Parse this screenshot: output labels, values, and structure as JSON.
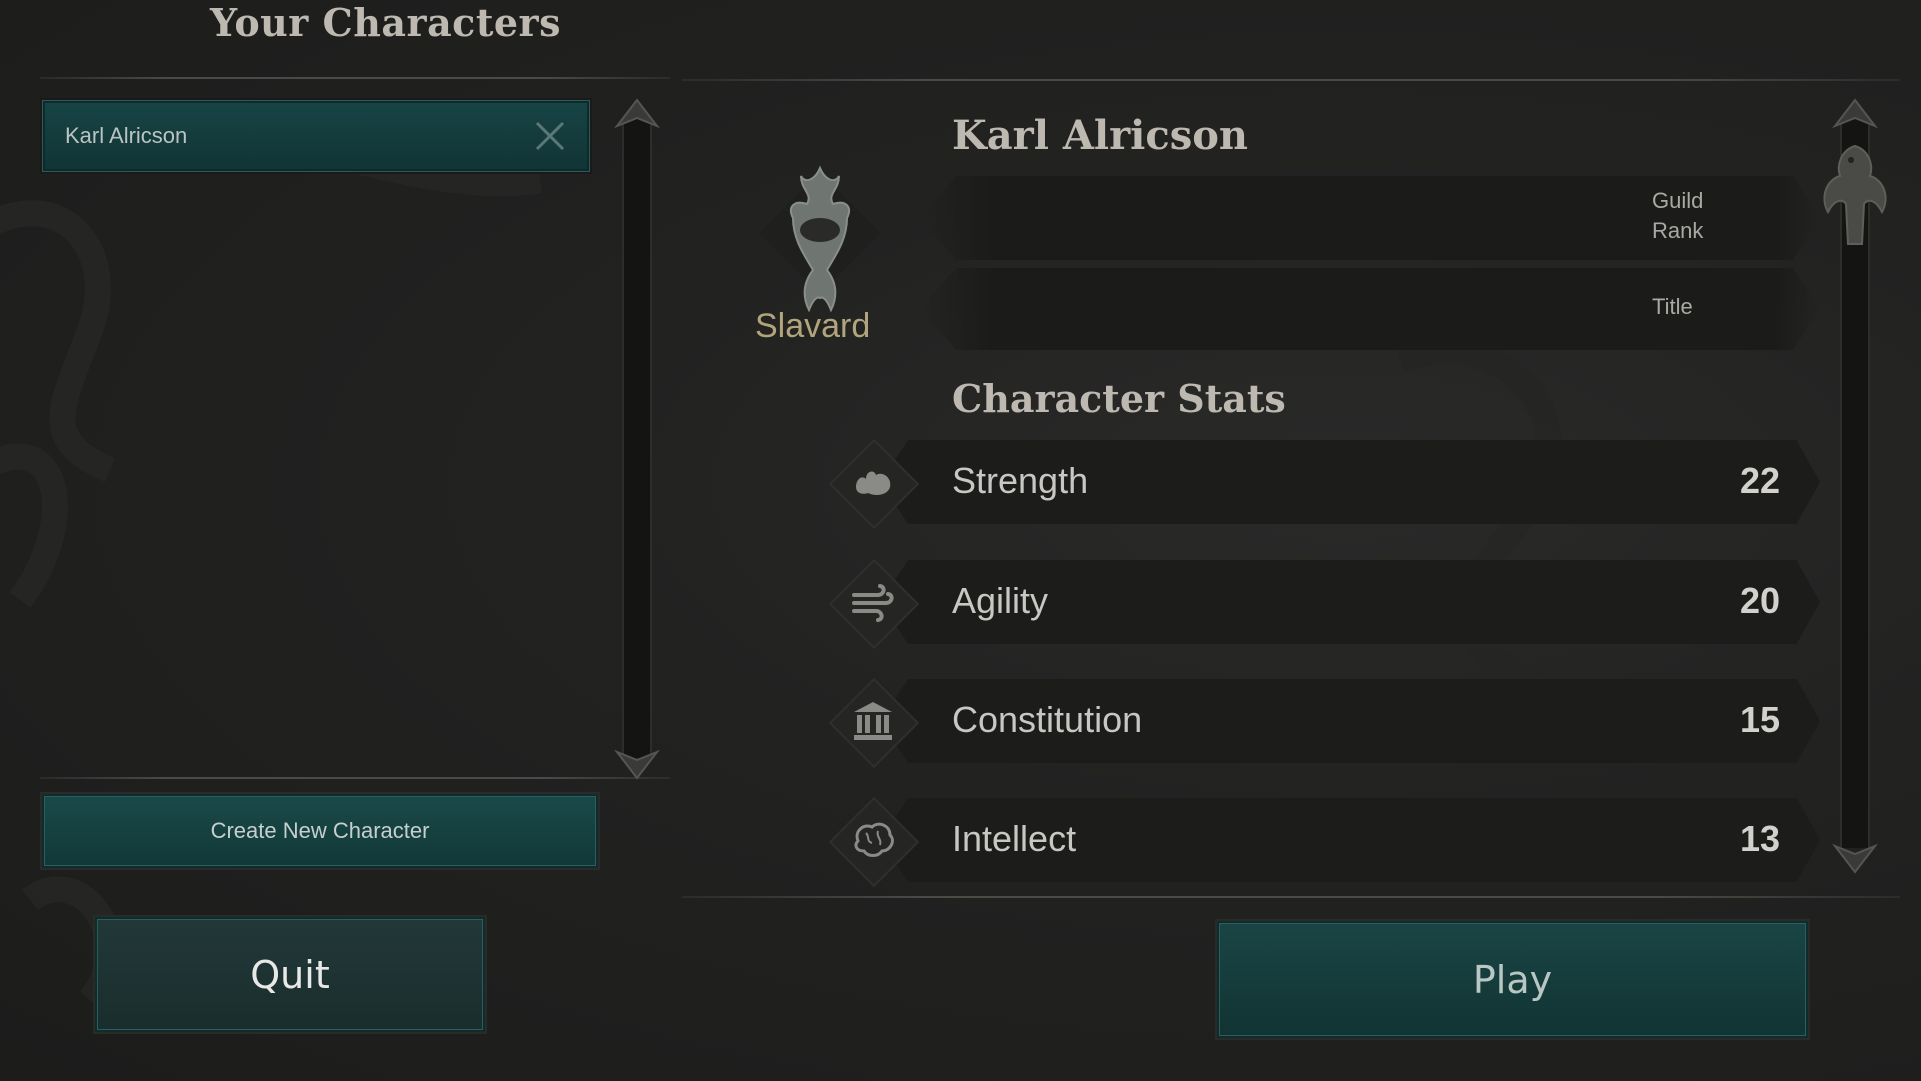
{
  "characters_panel": {
    "title": "Your Characters",
    "characters": [
      {
        "name": "Karl Alricson"
      }
    ],
    "create_button": "Create New Character"
  },
  "detail": {
    "name": "Karl Alricson",
    "class_name": "Slavard",
    "guild_rank_label": "Guild Rank",
    "title_label": "Title",
    "stats_heading": "Character Stats",
    "stats": [
      {
        "name": "Strength",
        "value": "22",
        "icon": "flexed-arm-icon"
      },
      {
        "name": "Agility",
        "value": "20",
        "icon": "wind-icon"
      },
      {
        "name": "Constitution",
        "value": "15",
        "icon": "pillar-building-icon"
      },
      {
        "name": "Intellect",
        "value": "13",
        "icon": "brain-icon"
      }
    ]
  },
  "footer": {
    "quit_label": "Quit",
    "play_label": "Play"
  },
  "colors": {
    "background": "#222221",
    "teal_button": "#174242",
    "class_name": "#b2a57d",
    "heading": "#bdb8b0"
  }
}
